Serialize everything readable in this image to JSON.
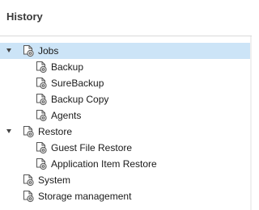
{
  "pane": {
    "title": "History"
  },
  "tree": {
    "jobs": {
      "label": "Jobs",
      "children": [
        "Backup",
        "SureBackup",
        "Backup Copy",
        "Agents"
      ]
    },
    "restore": {
      "label": "Restore",
      "children": [
        "Guest File Restore",
        "Application Item Restore"
      ]
    },
    "system": {
      "label": "System"
    },
    "storage": {
      "label": "Storage management"
    }
  },
  "colors": {
    "selection": "#cce4f7",
    "icon_stroke": "#555555",
    "gear_fill": "#e6e6e6"
  },
  "icons": {
    "expander": "expanded-triangle-icon",
    "node": "history-gear-document-icon"
  }
}
